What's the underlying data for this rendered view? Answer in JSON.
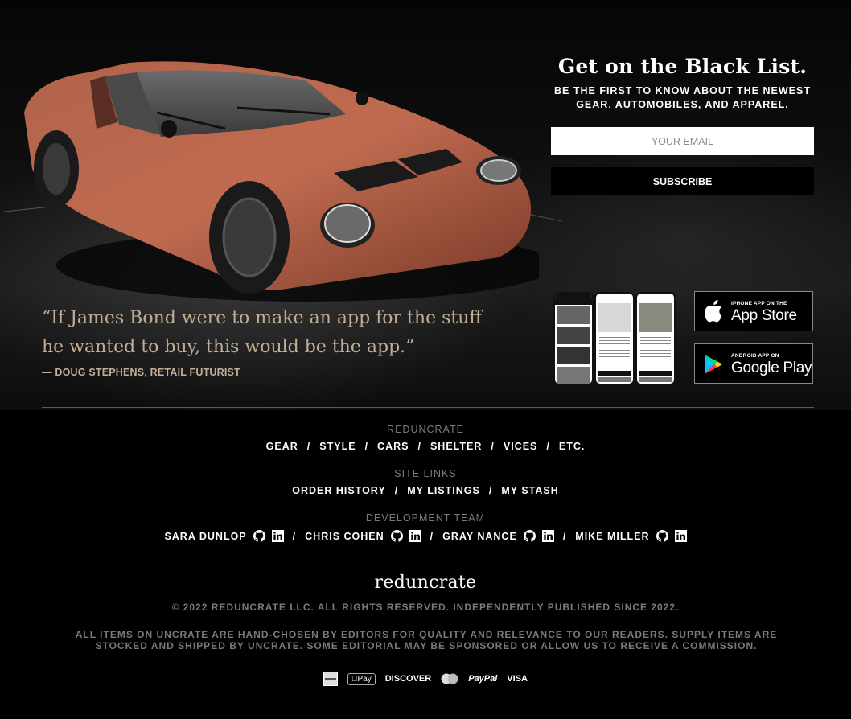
{
  "newsletter": {
    "title": "Get on the Black List.",
    "subtitle_line1": "BE THE FIRST TO KNOW ABOUT THE NEWEST",
    "subtitle_line2": "GEAR, AUTOMOBILES, AND APPAREL.",
    "email_placeholder": "YOUR EMAIL",
    "subscribe_label": "SUBSCRIBE"
  },
  "quote": {
    "line1": "“If James Bond were to make an app for the stuff",
    "line2": "he wanted to buy, this would be the app.”",
    "attribution": "— DOUG STEPHENS, RETAIL FUTURIST"
  },
  "apps": {
    "app_store": {
      "small": "IPHONE APP ON THE",
      "big": "App Store",
      "icon": "apple-icon"
    },
    "google_play": {
      "small": "ANDROID APP ON",
      "big": "Google Play",
      "icon": "google-play-icon"
    }
  },
  "footer": {
    "sections": [
      {
        "heading": "REDUNCRATE",
        "links": [
          "GEAR",
          "STYLE",
          "CARS",
          "SHELTER",
          "VICES",
          "ETC."
        ]
      },
      {
        "heading": "SITE LINKS",
        "links": [
          "ORDER HISTORY",
          "MY LISTINGS",
          "MY STASH"
        ]
      }
    ],
    "team_heading": "DEVELOPMENT TEAM",
    "team": [
      {
        "name": "SARA DUNLOP"
      },
      {
        "name": "CHRIS COHEN"
      },
      {
        "name": "GRAY NANCE"
      },
      {
        "name": "MIKE MILLER"
      }
    ],
    "separator": "/",
    "logo": "reduncrate",
    "copyright": "© 2022 REDUNCRATE LLC. ALL RIGHTS RESERVED. INDEPENDENTLY PUBLISHED SINCE 2022.",
    "disclaimer": "ALL ITEMS ON UNCRATE ARE HAND-CHOSEN BY EDITORS FOR QUALITY AND RELEVANCE TO OUR READERS. SUPPLY ITEMS ARE STOCKED AND SHIPPED BY UNCRATE. SOME EDITORIAL MAY BE SPONSORED OR ALLOW US TO RECEIVE A COMMISSION.",
    "payments": {
      "apple_pay": "Pay",
      "discover": "DISCOVER",
      "paypal": "PayPal",
      "visa": "VISA"
    }
  }
}
